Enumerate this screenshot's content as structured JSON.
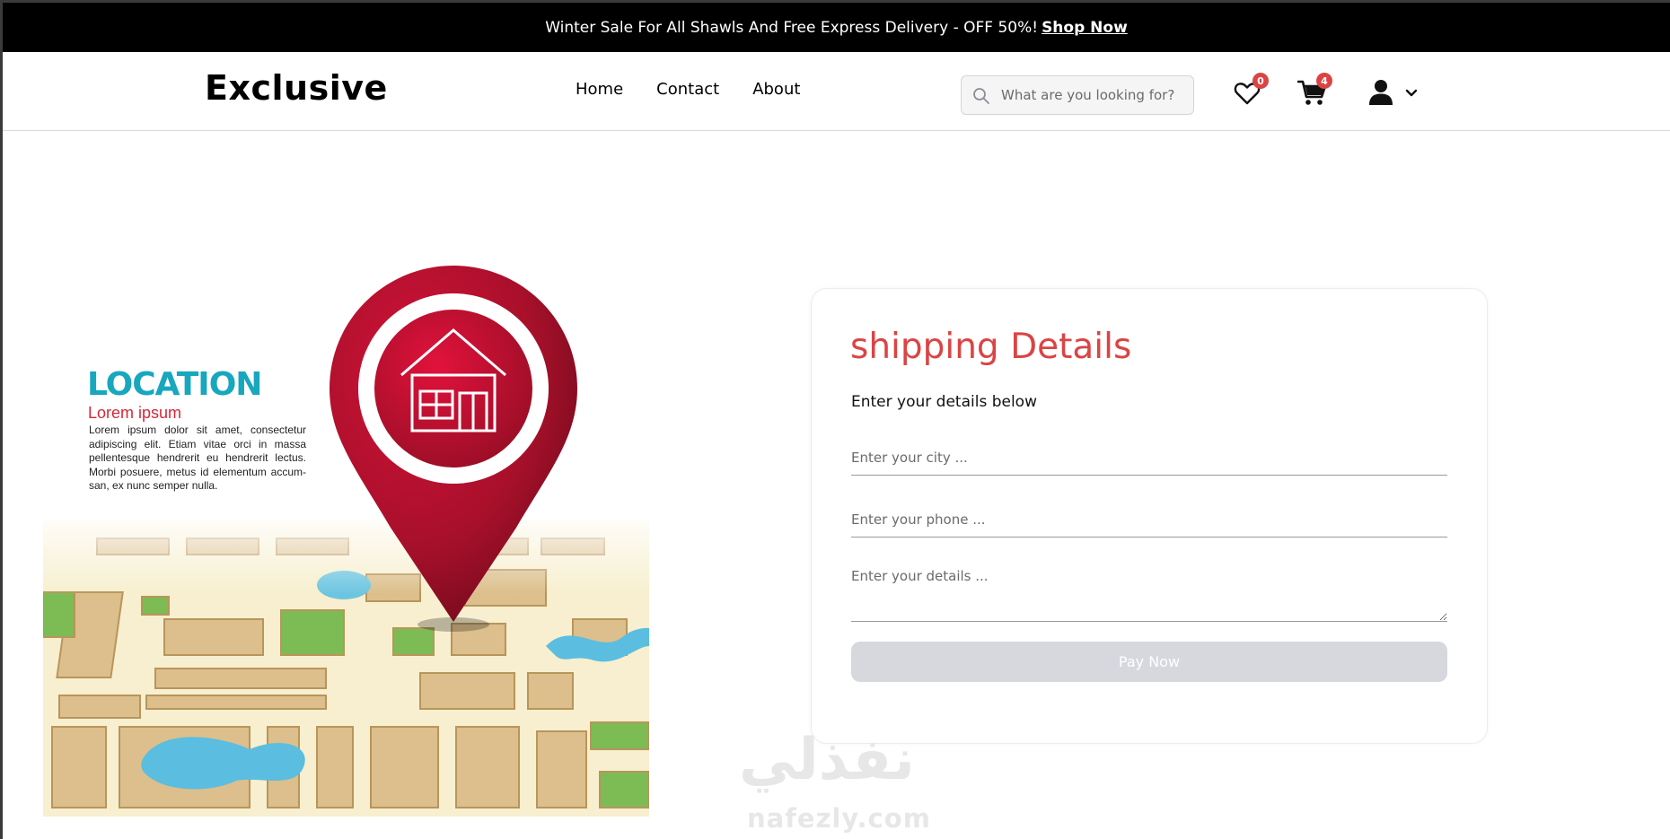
{
  "banner": {
    "text": "Winter Sale For All Shawls And Free Express Delivery - OFF 50%!",
    "link": "Shop Now"
  },
  "header": {
    "logo": "Exclusive",
    "nav": [
      "Home",
      "Contact",
      "About"
    ],
    "search_placeholder": "What are you looking for?",
    "wishlist_count": "0",
    "cart_count": "4"
  },
  "illustration": {
    "title": "LOCATION",
    "subtitle": "Lorem ipsum",
    "body": "Lorem ipsum dolor sit amet, consectetur adipiscing elit. Etiam vitae orci in massa pellentesque hendrerit eu hendrerit lectus. Morbi posuere, metus id elementum accum-san, ex nunc semper nulla."
  },
  "form": {
    "title": "shipping Details",
    "subtitle": "Enter your details below",
    "city_placeholder": "Enter your city ...",
    "phone_placeholder": "Enter your phone ...",
    "details_placeholder": "Enter your details ...",
    "submit_label": "Pay Now"
  },
  "watermark": {
    "arabic": "نفذلي",
    "latin": "nafezly.com"
  },
  "colors": {
    "accent": "#db4444",
    "location_teal": "#17a7be",
    "pin_red": "#b0102a",
    "button_disabled": "#d6d8de"
  }
}
